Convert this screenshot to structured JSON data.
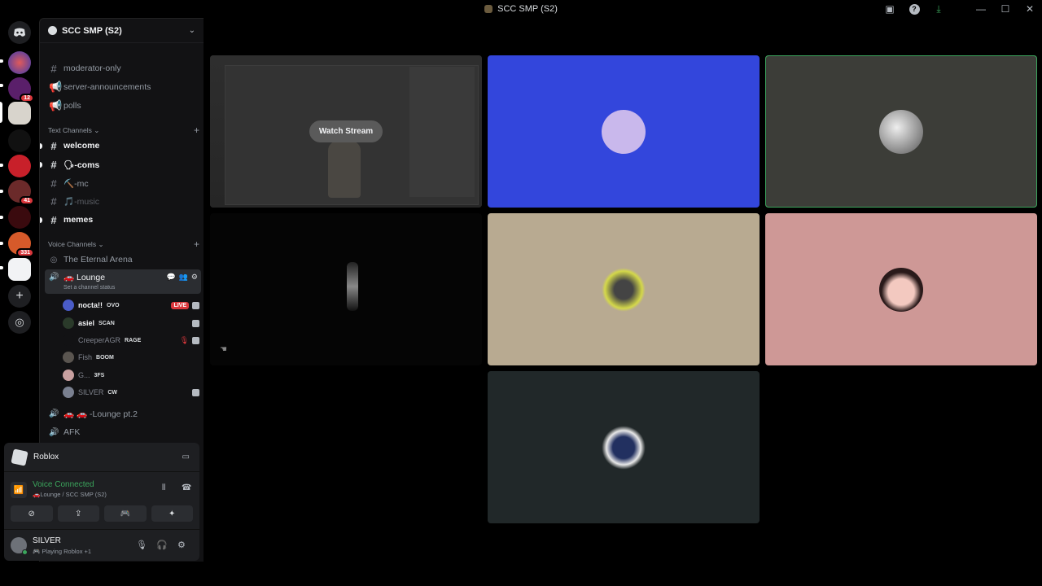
{
  "titlebar": {
    "title": "SCC SMP (S2)"
  },
  "rail": {
    "badges": [
      "12",
      "41",
      "331"
    ]
  },
  "server": {
    "name": "SCC SMP (S2)"
  },
  "channels": {
    "top": [
      "moderator-only",
      "server-announcements",
      "polls"
    ],
    "text_category": "Text Channels",
    "text": [
      "welcome",
      "🗣-coms",
      "⛏️-mc",
      "🎵-music",
      "memes"
    ],
    "voice_category": "Voice Channels",
    "voice_arena": "The Eternal Arena",
    "lounge": {
      "name": "🚗 Lounge",
      "status": "Set a channel status"
    },
    "lounge2": "🚗 🚗 -Lounge pt.2",
    "afk": "AFK"
  },
  "voice_users": [
    {
      "name": "nocta!!",
      "tag": "OVO",
      "live": "LIVE"
    },
    {
      "name": "asiel",
      "tag": "SCAN"
    },
    {
      "name": "CreeperAGR",
      "tag": "RAGE"
    },
    {
      "name": "Fish",
      "tag": "BOOM"
    },
    {
      "name": "G...",
      "tag": "3FS"
    },
    {
      "name": "SILVER",
      "tag": "CW"
    }
  ],
  "panel": {
    "activity": "Roblox",
    "voice_status": "Voice Connected",
    "voice_channel": "🚗Lounge / SCC SMP (S2)",
    "username": "SILVER",
    "user_status": "🎮 Playing Roblox +1"
  },
  "stage": {
    "watch_stream": "Watch Stream"
  },
  "colors": {
    "tile_blue": "#3346dc",
    "tile_olive": "#3c3d38",
    "tile_beige": "#b8aa91",
    "tile_pink": "#ce9896",
    "tile_slate": "#212829",
    "speaking": "#3ba55c"
  }
}
